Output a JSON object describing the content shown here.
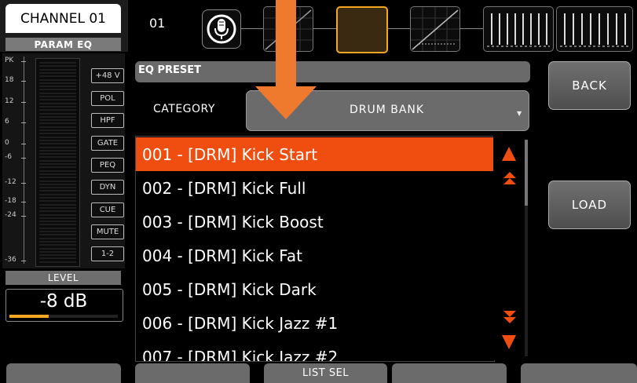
{
  "channel": {
    "title": "CHANNEL 01",
    "module": "PARAM EQ"
  },
  "meter_scale": [
    "PK",
    "18",
    "12",
    "6",
    "0",
    "-6",
    "-12",
    "-18",
    "-24",
    "-36"
  ],
  "strip_buttons": [
    "+48 V",
    "POL",
    "HPF",
    "GATE",
    "PEQ",
    "DYN",
    "CUE",
    "MUTE",
    "1-2"
  ],
  "level": {
    "label": "LEVEL",
    "value": "-8 dB",
    "fader_fraction": 0.6
  },
  "toolbar": {
    "channel_number": "01"
  },
  "eq_preset": {
    "title": "EQ PRESET"
  },
  "category": {
    "label": "CATEGORY",
    "value": "DRUM BANK"
  },
  "presets": [
    "001 - [DRM] Kick Start",
    "002 - [DRM] Kick Full",
    "003 - [DRM] Kick Boost",
    "004 - [DRM] Kick Fat",
    "005 - [DRM] Kick Dark",
    "006 - [DRM] Kick Jazz #1",
    "007 - [DRM] Kick Jazz #2"
  ],
  "selected_index": 0,
  "buttons": {
    "back": "BACK",
    "load": "LOAD"
  },
  "soft_keys": [
    "",
    "",
    "LIST SEL",
    "",
    ""
  ],
  "colors": {
    "accent": "#f04e10",
    "eq_highlight": "#f5a623",
    "arrow": "#ef7a2e"
  },
  "icons": [
    "microphone-icon",
    "scroll-up-icon",
    "page-up-icon",
    "page-down-icon",
    "scroll-down-icon"
  ]
}
